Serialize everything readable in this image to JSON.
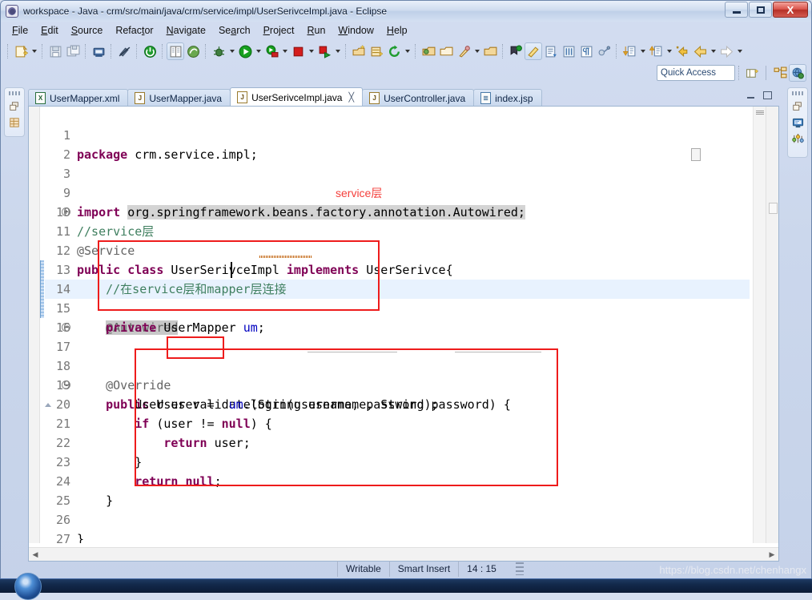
{
  "window": {
    "title": "workspace - Java - crm/src/main/java/crm/service/impl/UserSerivceImpl.java - Eclipse",
    "app_icon": "eclipse-icon",
    "buttons": {
      "minimize": "minimize",
      "maximize": "maximize",
      "close": "X"
    }
  },
  "menubar": {
    "items": [
      {
        "label": "File"
      },
      {
        "label": "Edit"
      },
      {
        "label": "Source"
      },
      {
        "label": "Refactor"
      },
      {
        "label": "Navigate"
      },
      {
        "label": "Search"
      },
      {
        "label": "Project"
      },
      {
        "label": "Run"
      },
      {
        "label": "Window"
      },
      {
        "label": "Help"
      }
    ]
  },
  "toolbar": {
    "quick_access_placeholder": "Quick Access",
    "icons": [
      "new-wizard-icon",
      "save-icon",
      "save-all-icon",
      "print-icon",
      "toggle-mark-occurrences-icon",
      "terminate-icon",
      "open-task-icon",
      "spring-icon",
      "debug-icon",
      "run-icon",
      "run-server-icon",
      "stop-icon",
      "run-last-tool-icon",
      "new-java-package-icon",
      "new-java-class-icon",
      "refresh-icon",
      "open-type-icon",
      "open-resource-icon",
      "search-icon",
      "last-edit-location-icon",
      "next-annotation-icon",
      "previous-annotation-icon",
      "back-icon",
      "forward-icon",
      "new-perspective-icon",
      "java-perspective-icon",
      "java-ee-perspective-icon"
    ]
  },
  "rails": {
    "left": {
      "icons": [
        "restore-icon",
        "package-explorer-icon"
      ]
    },
    "right": {
      "icons": [
        "restore-icon",
        "console-icon",
        "outline-icon"
      ]
    }
  },
  "editor": {
    "tabs": [
      {
        "label": "UserMapper.xml",
        "icon": "xml-file-icon",
        "active": false,
        "closable": false
      },
      {
        "label": "UserMapper.java",
        "icon": "java-file-icon",
        "active": false,
        "closable": false
      },
      {
        "label": "UserSerivceImpl.java",
        "icon": "java-file-icon",
        "active": true,
        "closable": true,
        "close_glyph": "╳"
      },
      {
        "label": "UserController.java",
        "icon": "java-file-icon",
        "active": false,
        "closable": false
      },
      {
        "label": "index.jsp",
        "icon": "jsp-file-icon",
        "active": false,
        "closable": false
      }
    ],
    "lines": [
      {
        "no": "1",
        "text": "package crm.service.impl;"
      },
      {
        "no": "2",
        "text": ""
      },
      {
        "no": "3",
        "text": "import org.springframework.beans.factory.annotation.Autowired;"
      },
      {
        "no": "9",
        "text": ""
      },
      {
        "no": "10",
        "text": "//service层"
      },
      {
        "no": "11",
        "text": "@Service"
      },
      {
        "no": "12",
        "text": "public class UserSerivceImpl implements UserSerivce{"
      },
      {
        "no": "13",
        "text": "    //在service层和mapper层连接"
      },
      {
        "no": "14",
        "text": "    @Autowired"
      },
      {
        "no": "15",
        "text": "    private UserMapper um;"
      },
      {
        "no": "16",
        "text": ""
      },
      {
        "no": "17",
        "text": "    @Override"
      },
      {
        "no": "18",
        "text": "    public User validate(String username, String password) {"
      },
      {
        "no": "19",
        "text": "        User user =  um.login(username, password);"
      },
      {
        "no": "20",
        "text": "        if (user != null) {"
      },
      {
        "no": "21",
        "text": "            return user;"
      },
      {
        "no": "22",
        "text": "        }"
      },
      {
        "no": "23",
        "text": "        return null;"
      },
      {
        "no": "24",
        "text": "    }"
      },
      {
        "no": "25",
        "text": ""
      },
      {
        "no": "26",
        "text": "}"
      },
      {
        "no": "27",
        "text": ""
      }
    ],
    "annotations": {
      "service_label": "service层",
      "accent_color": "#ee1c1c"
    }
  },
  "statusbar": {
    "writable": "Writable",
    "insert_mode": "Smart Insert",
    "cursor_position": "14 : 15",
    "watermark": "https://blog.csdn.net/chenhangx"
  }
}
